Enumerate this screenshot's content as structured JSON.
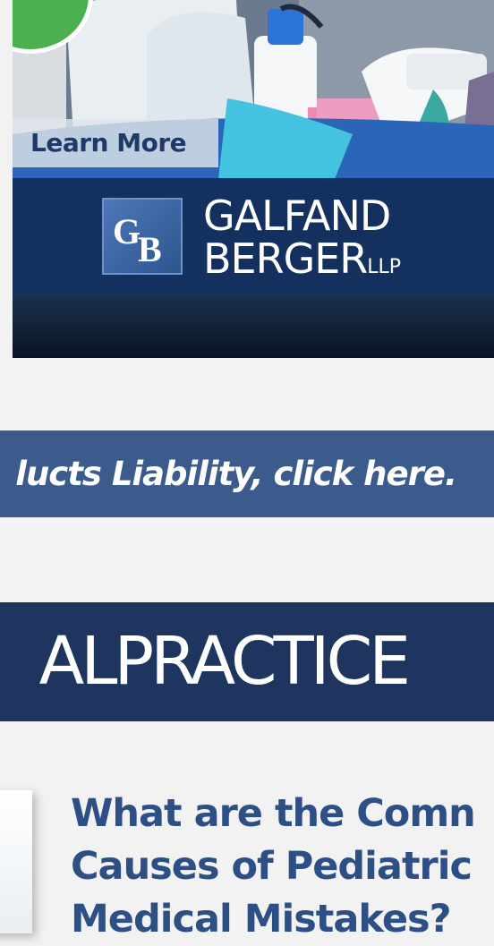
{
  "ad": {
    "learn_more": "Learn More",
    "logo_mark": [
      "G",
      "B"
    ],
    "brand_line1": "GALFAND",
    "brand_line2": "BERGER",
    "brand_suffix": "LLP",
    "colors": {
      "band": "#13305f",
      "badge": "#4caf50"
    }
  },
  "link_bar": {
    "text": "lucts Liability, click here."
  },
  "section": {
    "title": "ALPRACTICE"
  },
  "article": {
    "title_lines": [
      "What are the Comn",
      "Causes of Pediatric",
      "Medical Mistakes?"
    ]
  }
}
